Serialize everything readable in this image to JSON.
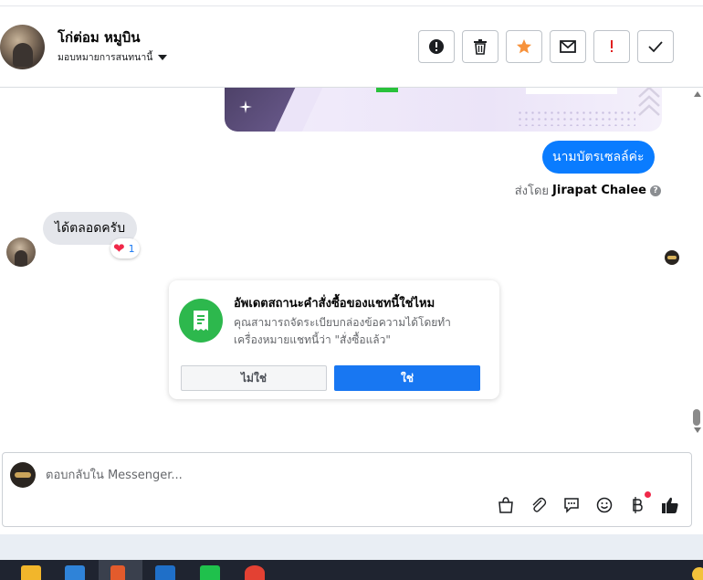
{
  "header": {
    "contact_name": "โก่ต่อม หมูบิน",
    "assign_label": "มอบหมายการสนทนานี้",
    "tools": [
      {
        "name": "spam-button",
        "icon": "alert-circle-icon"
      },
      {
        "name": "delete-button",
        "icon": "trash-icon"
      },
      {
        "name": "star-button",
        "icon": "star-icon",
        "color": "#f7923b"
      },
      {
        "name": "mark-unread-button",
        "icon": "envelope-icon"
      },
      {
        "name": "follow-up-button",
        "icon": "exclamation-icon",
        "color": "#e02020"
      },
      {
        "name": "done-button",
        "icon": "check-icon"
      }
    ]
  },
  "chat": {
    "outgoing_message": "นามบัตรเซลล์ค่ะ",
    "sent_by_prefix": "ส่งโดย",
    "sent_by_name": "Jirapat Chalee",
    "help_icon": "?",
    "incoming_message": "ได้ตลอดครับ",
    "reaction_count": "1",
    "reaction_icon": "heart-icon"
  },
  "order_card": {
    "title": "อัพเดตสถานะคำสั่งซื้อของแชทนี้ใช่ไหม",
    "body": "คุณสามารถจัดระเบียบกล่องข้อความได้โดยทำเครื่องหมายแชทนี้ว่า \"สั่งซื้อแล้ว\"",
    "no_label": "ไม่ใช่",
    "yes_label": "ใช่",
    "icon": "receipt-icon",
    "icon_color": "#2db84d"
  },
  "composer": {
    "placeholder": "ตอบกลับใน Messenger...",
    "tools": [
      "shopping-bag-icon",
      "paperclip-icon",
      "saved-replies-icon",
      "emoji-icon",
      "baht-icon",
      "like-icon"
    ]
  },
  "colors": {
    "accent": "#1877f2",
    "outgoing_bubble": "#0a7cff",
    "incoming_bubble": "#e4e6eb"
  }
}
